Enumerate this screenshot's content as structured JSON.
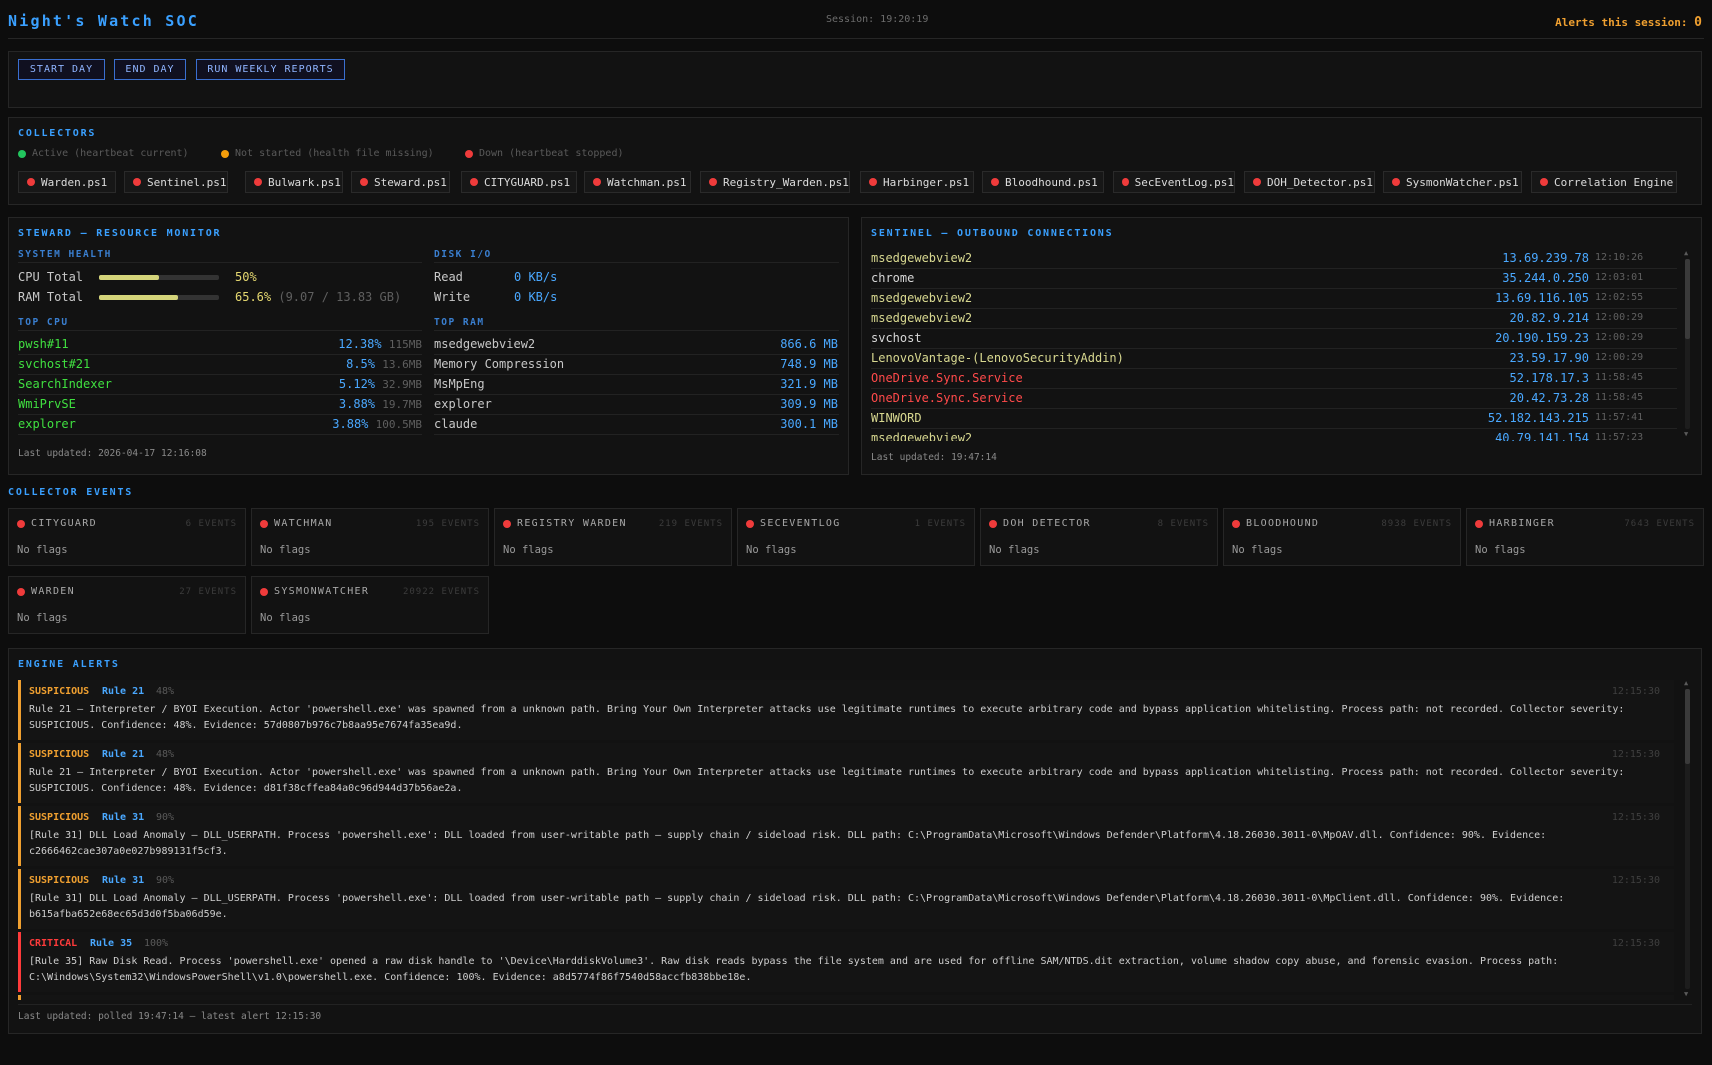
{
  "header": {
    "title": "Night's Watch SOC",
    "session": "Session: 19:20:19",
    "alerts_label": "Alerts this session:",
    "alerts_count": "0"
  },
  "toolbar": {
    "start_day": "START DAY",
    "end_day": "END DAY",
    "run_weekly": "RUN WEEKLY REPORTS"
  },
  "collectors": {
    "title": "COLLECTORS",
    "legend": {
      "active": "Active (heartbeat current)",
      "not_started": "Not started (health file missing)",
      "down": "Down (heartbeat stopped)"
    },
    "items": [
      "Warden.ps1",
      "Sentinel.ps1",
      "Bulwark.ps1",
      "Steward.ps1",
      "CITYGUARD.ps1",
      "Watchman.ps1",
      "Registry_Warden.ps1",
      "Harbinger.ps1",
      "Bloodhound.ps1",
      "SecEventLog.ps1",
      "DOH_Detector.ps1",
      "SysmonWatcher.ps1",
      "Correlation Engine"
    ],
    "status": "down"
  },
  "steward": {
    "title": "STEWARD — RESOURCE MONITOR",
    "system_health_label": "SYSTEM HEALTH",
    "cpu_label": "CPU Total",
    "cpu_value": "50%",
    "cpu_level": 0.5,
    "ram_label": "RAM Total",
    "ram_value": "65.6%",
    "ram_detail": "(9.07 / 13.83 GB)",
    "ram_level": 0.656,
    "disk_label": "DISK I/O",
    "read_label": "Read",
    "read_value": "0 KB/s",
    "write_label": "Write",
    "write_value": "0 KB/s",
    "top_cpu_label": "TOP CPU",
    "top_cpu": [
      {
        "name": "pwsh#11",
        "pct": "12.38%",
        "mem": "115MB"
      },
      {
        "name": "svchost#21",
        "pct": "8.5%",
        "mem": "13.6MB"
      },
      {
        "name": "SearchIndexer",
        "pct": "5.12%",
        "mem": "32.9MB"
      },
      {
        "name": "WmiPrvSE",
        "pct": "3.88%",
        "mem": "19.7MB"
      },
      {
        "name": "explorer",
        "pct": "3.88%",
        "mem": "100.5MB"
      }
    ],
    "top_ram_label": "TOP RAM",
    "top_ram": [
      {
        "name": "msedgewebview2",
        "mem": "866.6 MB"
      },
      {
        "name": "Memory Compression",
        "mem": "748.9 MB"
      },
      {
        "name": "MsMpEng",
        "mem": "321.9 MB"
      },
      {
        "name": "explorer",
        "mem": "309.9 MB"
      },
      {
        "name": "claude",
        "mem": "300.1 MB"
      }
    ],
    "last_updated": "Last updated: 2026-04-17 12:16:08"
  },
  "sentinel": {
    "title": "SENTINEL — OUTBOUND CONNECTIONS",
    "connections": [
      {
        "proc": "msedgewebview2",
        "ip": "13.69.239.78",
        "time": "12:10:26",
        "style": "yellow"
      },
      {
        "proc": "chrome",
        "ip": "35.244.0.250",
        "time": "12:03:01",
        "style": "yellow"
      },
      {
        "proc": "msedgewebview2",
        "ip": "13.69.116.105",
        "time": "12:02:55",
        "style": "yellow"
      },
      {
        "proc": "msedgewebview2",
        "ip": "20.82.9.214",
        "time": "12:00:29",
        "style": "yellow"
      },
      {
        "proc": "svchost",
        "ip": "20.190.159.23",
        "time": "12:00:29",
        "style": "yellow"
      },
      {
        "proc": "LenovoVantage-(LenovoSecurityAddin)",
        "ip": "23.59.17.90",
        "time": "12:00:29",
        "style": "yellow"
      },
      {
        "proc": "OneDrive.Sync.Service",
        "ip": "52.178.17.3",
        "time": "11:58:45",
        "style": "red"
      },
      {
        "proc": "OneDrive.Sync.Service",
        "ip": "20.42.73.28",
        "time": "11:58:45",
        "style": "red"
      },
      {
        "proc": "WINWORD",
        "ip": "52.182.143.215",
        "time": "11:57:41",
        "style": "yellow"
      },
      {
        "proc": "msedgewebview2",
        "ip": "40.79.141.154",
        "time": "11:57:23",
        "style": "yellow"
      }
    ],
    "last_updated": "Last updated: 19:47:14"
  },
  "collector_events": {
    "title": "COLLECTOR EVENTS",
    "cards": [
      {
        "name": "CITYGUARD",
        "count": "6 EVENTS",
        "flags": "No flags"
      },
      {
        "name": "WATCHMAN",
        "count": "195 EVENTS",
        "flags": "No flags"
      },
      {
        "name": "REGISTRY WARDEN",
        "count": "219 EVENTS",
        "flags": "No flags"
      },
      {
        "name": "SECEVENTLOG",
        "count": "1 EVENTS",
        "flags": "No flags"
      },
      {
        "name": "DOH DETECTOR",
        "count": "8 EVENTS",
        "flags": "No flags"
      },
      {
        "name": "BLOODHOUND",
        "count": "8938 EVENTS",
        "flags": "No flags"
      },
      {
        "name": "HARBINGER",
        "count": "7643 EVENTS",
        "flags": "No flags"
      },
      {
        "name": "WARDEN",
        "count": "27 EVENTS",
        "flags": "No flags"
      },
      {
        "name": "SYSMONWATCHER",
        "count": "20922 EVENTS",
        "flags": "No flags"
      }
    ]
  },
  "engine_alerts": {
    "title": "ENGINE ALERTS",
    "alerts": [
      {
        "severity": "SUSPICIOUS",
        "rule": "Rule 21",
        "confidence": "48%",
        "time": "12:15:30",
        "message": "Rule 21 — Interpreter / BYOI Execution. Actor 'powershell.exe' was spawned from a unknown path. Bring Your Own Interpreter attacks use legitimate runtimes to execute arbitrary code and bypass application whitelisting. Process path: not recorded. Collector severity: SUSPICIOUS. Confidence: 48%. Evidence: 57d0807b976c7b8aa95e7674fa35ea9d."
      },
      {
        "severity": "SUSPICIOUS",
        "rule": "Rule 21",
        "confidence": "48%",
        "time": "12:15:30",
        "message": "Rule 21 — Interpreter / BYOI Execution. Actor 'powershell.exe' was spawned from a unknown path. Bring Your Own Interpreter attacks use legitimate runtimes to execute arbitrary code and bypass application whitelisting. Process path: not recorded. Collector severity: SUSPICIOUS. Confidence: 48%. Evidence: d81f38cffea84a0c96d944d37b56ae2a."
      },
      {
        "severity": "SUSPICIOUS",
        "rule": "Rule 31",
        "confidence": "90%",
        "time": "12:15:30",
        "message": "[Rule 31] DLL Load Anomaly — DLL_USERPATH. Process 'powershell.exe': DLL loaded from user-writable path — supply chain / sideload risk. DLL path: C:\\ProgramData\\Microsoft\\Windows Defender\\Platform\\4.18.26030.3011-0\\MpOAV.dll. Confidence: 90%. Evidence: c2666462cae307a0e027b989131f5cf3."
      },
      {
        "severity": "SUSPICIOUS",
        "rule": "Rule 31",
        "confidence": "90%",
        "time": "12:15:30",
        "message": "[Rule 31] DLL Load Anomaly — DLL_USERPATH. Process 'powershell.exe': DLL loaded from user-writable path — supply chain / sideload risk. DLL path: C:\\ProgramData\\Microsoft\\Windows Defender\\Platform\\4.18.26030.3011-0\\MpClient.dll. Confidence: 90%. Evidence: b615afba652e68ec65d3d0f5ba06d59e."
      },
      {
        "severity": "CRITICAL",
        "rule": "Rule 35",
        "confidence": "100%",
        "time": "12:15:30",
        "message": "[Rule 35] Raw Disk Read. Process 'powershell.exe' opened a raw disk handle to '\\Device\\HarddiskVolume3'. Raw disk reads bypass the file system and are used for offline SAM/NTDS.dit extraction, volume shadow copy abuse, and forensic evasion. Process path: C:\\Windows\\System32\\WindowsPowerShell\\v1.0\\powershell.exe. Confidence: 100%. Evidence: a8d5774f86f7540d58accfb838bbe18e."
      }
    ],
    "last_updated": "Last updated: polled 19:47:14 — latest alert 12:15:30"
  },
  "colors": {
    "accent": "#3aa0ff",
    "suspicious": "#f0a030",
    "critical": "#ff3b3b",
    "active": "#22c55e",
    "not_started": "#f59e0b",
    "down": "#ef3b3b"
  }
}
